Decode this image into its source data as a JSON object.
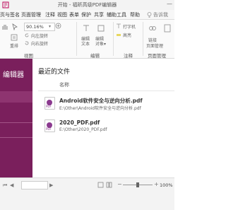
{
  "window": {
    "title": "开始 - 福昕高级PDF编辑器",
    "accent": "#7a1f5c",
    "minimize_label": "—"
  },
  "menubar": [
    "页与签名",
    "页面管理",
    "注释",
    "视图",
    "表单",
    "保护",
    "共享",
    "辅助工具",
    "帮助"
  ],
  "search_hint": "告诉我",
  "ribbon": {
    "zoom_value": "90.16%",
    "rotate_left": "向左旋转",
    "rotate_right": "向右旋转",
    "reflow": "重排",
    "edit_text": "编辑\n文本",
    "edit_object": "编辑\n对象",
    "typewriter": "打字机",
    "highlight": "高亮",
    "link": "链接",
    "page_manage": "页面管理",
    "groups": {
      "view": "视图",
      "edit": "编辑",
      "comment": "注释",
      "pages": "页面管理"
    }
  },
  "sidebar": {
    "title": "编辑器"
  },
  "main": {
    "section_title": "最近的文件",
    "column_name": "名称",
    "files": [
      {
        "name": "Android软件安全与逆向分析.pdf",
        "path": "E:\\Other\\Android软件安全与逆向分析.pdf",
        "icon_label": "PDF"
      },
      {
        "name": "2020_PDF.pdf",
        "path": "E:\\Other\\2020_PDF.pdf",
        "icon_label": "PDF"
      }
    ]
  },
  "statusbar": {
    "zoom": "100%"
  }
}
